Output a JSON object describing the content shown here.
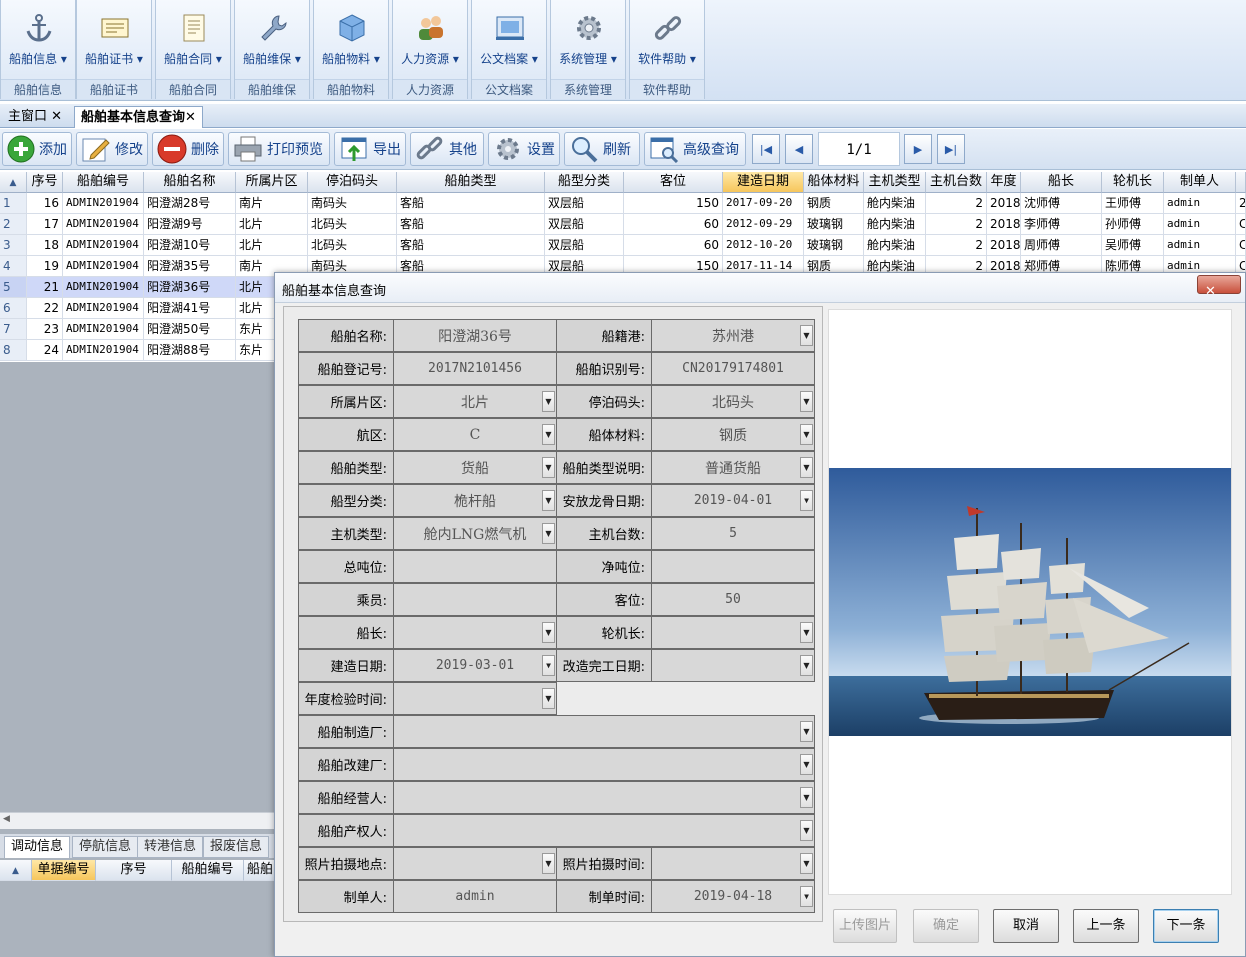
{
  "ribbon": {
    "groups": [
      {
        "label": "船舶信息",
        "caption": "船舶信息",
        "icon": "anchor-icon"
      },
      {
        "label": "船舶证书",
        "caption": "船舶证书",
        "icon": "certificate-icon"
      },
      {
        "label": "船舶合同",
        "caption": "船舶合同",
        "icon": "contract-icon"
      },
      {
        "label": "船舶维保",
        "caption": "船舶维保",
        "icon": "wrench-icon"
      },
      {
        "label": "船舶物料",
        "caption": "船舶物料",
        "icon": "cube-icon"
      },
      {
        "label": "人力资源",
        "caption": "人力资源",
        "icon": "users-icon"
      },
      {
        "label": "公文档案",
        "caption": "公文档案",
        "icon": "archive-icon"
      },
      {
        "label": "系统管理",
        "caption": "系统管理",
        "icon": "gear-icon"
      },
      {
        "label": "软件帮助",
        "caption": "软件帮助",
        "icon": "link-icon"
      }
    ]
  },
  "tabs": {
    "main": "主窗口",
    "query": "船舶基本信息查询",
    "close": "✕"
  },
  "toolbar": {
    "add": "添加",
    "edit": "修改",
    "delete": "删除",
    "print_preview": "打印预览",
    "export": "导出",
    "other": "其他",
    "settings": "设置",
    "refresh": "刷新",
    "advanced_query": "高级查询",
    "page": "1/1"
  },
  "grid": {
    "headers": [
      "序号",
      "船舶编号",
      "船舶名称",
      "所属片区",
      "停泊码头",
      "船舶类型",
      "船型分类",
      "客位",
      "建造日期",
      "船体材料",
      "主机类型",
      "主机台数",
      "年度",
      "船长",
      "轮机长",
      "制单人"
    ],
    "rows": [
      {
        "rn": "1",
        "seq": "16",
        "code": "ADMIN201904",
        "name": "阳澄湖28号",
        "area": "南片",
        "dock": "南码头",
        "type": "客船",
        "class": "双层船",
        "seats": "150",
        "built": "2017-09-20",
        "material": "钢质",
        "engine": "舱内柴油",
        "engines": "2",
        "year": "2018",
        "captain": "沈师傅",
        "chief": "王师傅",
        "maker": "admin",
        "extra": "2"
      },
      {
        "rn": "2",
        "seq": "17",
        "code": "ADMIN201904",
        "name": "阳澄湖9号",
        "area": "北片",
        "dock": "北码头",
        "type": "客船",
        "class": "双层船",
        "seats": "60",
        "built": "2012-09-29",
        "material": "玻璃钢",
        "engine": "舱内柴油",
        "engines": "2",
        "year": "2018",
        "captain": "李师傅",
        "chief": "孙师傅",
        "maker": "admin",
        "extra": "C"
      },
      {
        "rn": "3",
        "seq": "18",
        "code": "ADMIN201904",
        "name": "阳澄湖10号",
        "area": "北片",
        "dock": "北码头",
        "type": "客船",
        "class": "双层船",
        "seats": "60",
        "built": "2012-10-20",
        "material": "玻璃钢",
        "engine": "舱内柴油",
        "engines": "2",
        "year": "2018",
        "captain": "周师傅",
        "chief": "吴师傅",
        "maker": "admin",
        "extra": "C"
      },
      {
        "rn": "4",
        "seq": "19",
        "code": "ADMIN201904",
        "name": "阳澄湖35号",
        "area": "南片",
        "dock": "南码头",
        "type": "客船",
        "class": "双层船",
        "seats": "150",
        "built": "2017-11-14",
        "material": "钢质",
        "engine": "舱内柴油",
        "engines": "2",
        "year": "2018",
        "captain": "郑师傅",
        "chief": "陈师傅",
        "maker": "admin",
        "extra": "C"
      },
      {
        "rn": "5",
        "seq": "21",
        "code": "ADMIN201904",
        "name": "阳澄湖36号",
        "area": "北片"
      },
      {
        "rn": "6",
        "seq": "22",
        "code": "ADMIN201904",
        "name": "阳澄湖41号",
        "area": "北片"
      },
      {
        "rn": "7",
        "seq": "23",
        "code": "ADMIN201904",
        "name": "阳澄湖50号",
        "area": "东片"
      },
      {
        "rn": "8",
        "seq": "24",
        "code": "ADMIN201904",
        "name": "阳澄湖88号",
        "area": "东片"
      }
    ]
  },
  "subtabs": [
    "调动信息",
    "停航信息",
    "转港信息",
    "报废信息"
  ],
  "subgrid": {
    "headers": [
      "单据编号",
      "序号",
      "船舶编号",
      "船舶"
    ]
  },
  "dialog": {
    "title": "船舶基本信息查询",
    "close": "✕",
    "fields": {
      "ship_name_label": "船舶名称:",
      "ship_name": "阳澄湖36号",
      "port_label": "船籍港:",
      "port": "苏州港",
      "reg_no_label": "船舶登记号:",
      "reg_no": "2017N2101456",
      "ident_no_label": "船舶识别号:",
      "ident_no": "CN20179174801",
      "area_label": "所属片区:",
      "area": "北片",
      "dock_label": "停泊码头:",
      "dock": "北码头",
      "zone_label": "航区:",
      "zone": "C",
      "material_label": "船体材料:",
      "material": "钢质",
      "type_label": "船舶类型:",
      "type": "货船",
      "type_desc_label": "船舶类型说明:",
      "type_desc": "普通货船",
      "class_label": "船型分类:",
      "class": "桅杆船",
      "keel_date_label": "安放龙骨日期:",
      "keel_date": "2019-04-01",
      "engine_type_label": "主机类型:",
      "engine_type": "舱内LNG燃气机",
      "engine_count_label": "主机台数:",
      "engine_count": "5",
      "gross_ton_label": "总吨位:",
      "gross_ton": "",
      "net_ton_label": "净吨位:",
      "net_ton": "",
      "crew_label": "乘员:",
      "crew": "",
      "seats_label": "客位:",
      "seats": "50",
      "captain_label": "船长:",
      "captain": "",
      "chief_label": "轮机长:",
      "chief": "",
      "built_label": "建造日期:",
      "built": "2019-03-01",
      "rebuilt_label": "改造完工日期:",
      "rebuilt": "",
      "annual_label": "年度检验时间:",
      "annual": "",
      "builder_label": "船舶制造厂:",
      "builder": "",
      "rebuilder_label": "船舶改建厂:",
      "rebuilder": "",
      "operator_label": "船舶经营人:",
      "operator": "",
      "owner_label": "船舶产权人:",
      "owner": "",
      "photo_place_label": "照片拍摄地点:",
      "photo_place": "",
      "photo_time_label": "照片拍摄时间:",
      "photo_time": "",
      "maker_label": "制单人:",
      "maker": "admin",
      "make_time_label": "制单时间:",
      "make_time": "2019-04-18"
    },
    "buttons": {
      "upload": "上传图片",
      "ok": "确定",
      "cancel": "取消",
      "prev": "上一条",
      "next": "下一条"
    }
  }
}
